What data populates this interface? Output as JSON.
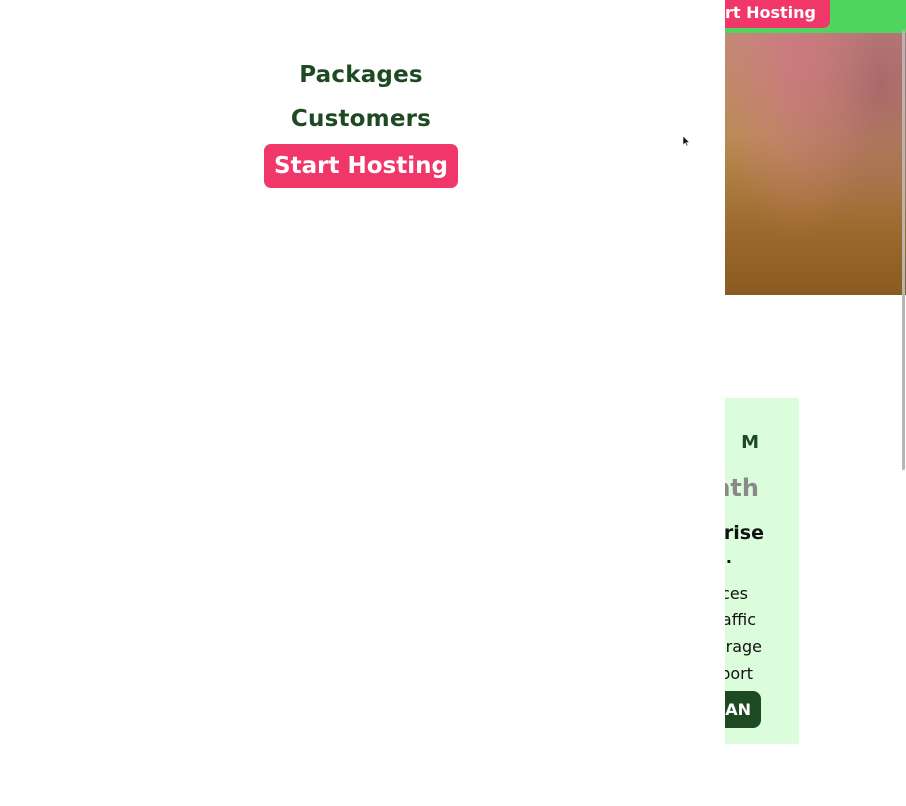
{
  "nav": {
    "links": [
      {
        "label": "Packages"
      },
      {
        "label": "Customers"
      }
    ],
    "cta_label": "Start Hosting"
  },
  "header": {
    "cta_label": "Start Hosting",
    "accent_color": "#4fd460",
    "cta_color": "#f1376a"
  },
  "plan_card": {
    "name": "M",
    "price": "nth",
    "tier": "prise",
    "tier_sub": ".",
    "features": [
      "ces",
      "affic",
      "rage",
      "port"
    ],
    "button_label": "AN",
    "background_color": "#dcfddc"
  },
  "colors": {
    "nav_text": "#1d4a22",
    "primary_dark": "#1d4a22",
    "cta": "#f1376a"
  }
}
